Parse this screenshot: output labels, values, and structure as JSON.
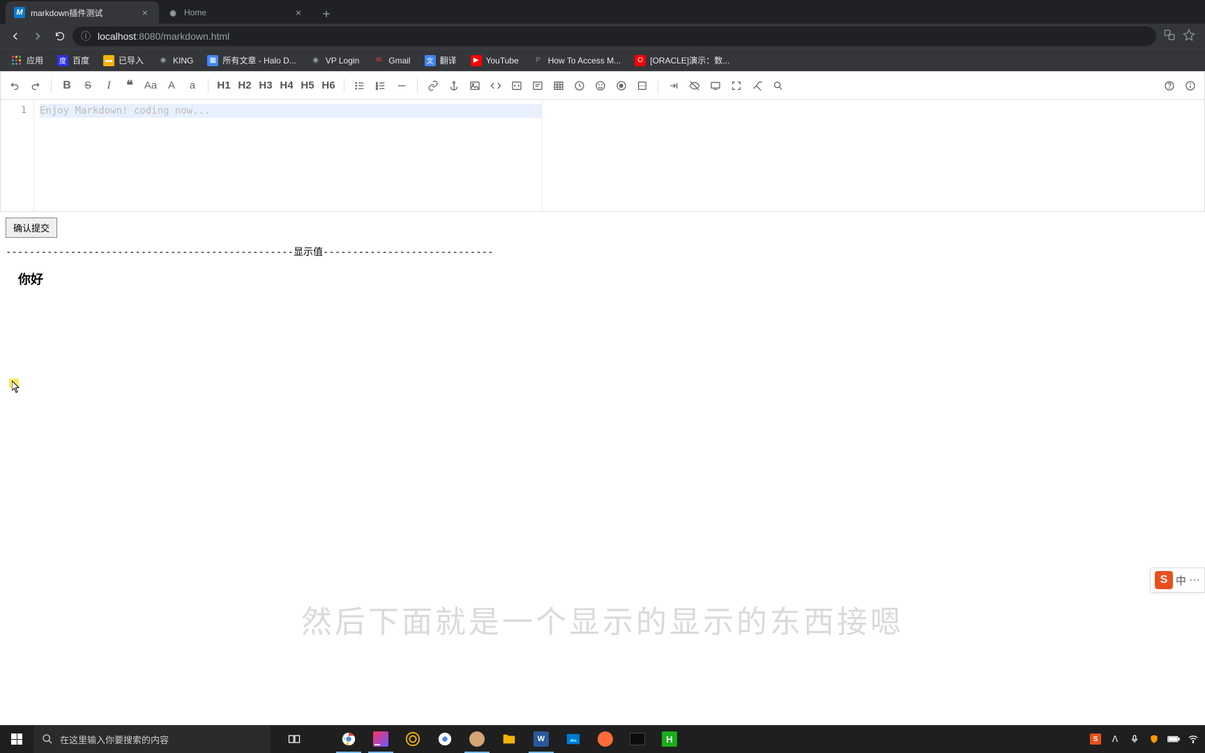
{
  "browser": {
    "tabs": [
      {
        "title": "markdown插件测试",
        "favicon_letter": "M",
        "favicon_bg": "#0b79d0",
        "favicon_color": "#fff",
        "active": true
      },
      {
        "title": "Home",
        "favicon_letter": "◉",
        "favicon_bg": "transparent",
        "favicon_color": "#9aa0a6",
        "active": false
      }
    ],
    "url_host": "localhost",
    "url_port_path": ":8080/markdown.html"
  },
  "bookmarks": [
    {
      "label": "应用",
      "icon": "grid",
      "color": "#e8eaed"
    },
    {
      "label": "百度",
      "icon": "paw",
      "color": "#2932e1"
    },
    {
      "label": "已导入",
      "icon": "folder",
      "color": "#f4b400"
    },
    {
      "label": "KING",
      "icon": "globe",
      "color": "#9aa0a6"
    },
    {
      "label": "所有文章 - Halo D...",
      "icon": "doc",
      "color": "#4285f4"
    },
    {
      "label": "VP Login",
      "icon": "globe",
      "color": "#9aa0a6"
    },
    {
      "label": "Gmail",
      "icon": "mail",
      "color": "#ea4335"
    },
    {
      "label": "翻译",
      "icon": "trans",
      "color": "#4285f4"
    },
    {
      "label": "YouTube",
      "icon": "yt",
      "color": "#ff0000"
    },
    {
      "label": "How To Access M...",
      "icon": "p",
      "color": "#666"
    },
    {
      "label": "[ORACLE]演示：数...",
      "icon": "o",
      "color": "#f80000"
    }
  ],
  "editor": {
    "placeholder": "Enjoy Markdown! coding now...",
    "line_number": "1",
    "headings": {
      "h1": "H1",
      "h2": "H2",
      "h3": "H3",
      "h4": "H4",
      "h5": "H5",
      "h6": "H6"
    },
    "case": {
      "mixed": "Aa",
      "upper": "A",
      "lower": "a"
    }
  },
  "actions": {
    "submit": "确认提交"
  },
  "divider": "-------------------------------------------------显示值-----------------------------",
  "display_heading": "你好",
  "subtitle": "然后下面就是一个显示的显示的东西接嗯",
  "ime": {
    "brand": "S",
    "mode": "中"
  },
  "taskbar": {
    "search_placeholder": "在这里输入你要搜索的内容"
  }
}
